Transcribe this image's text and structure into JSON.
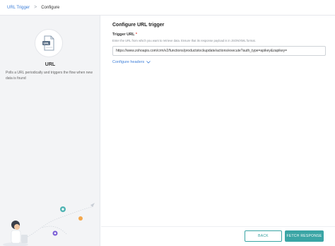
{
  "breadcrumb": {
    "parent": "URL Trigger",
    "separator": ">",
    "current": "Configure"
  },
  "app": {
    "icon_name": "url-file-icon",
    "icon_text": "URL",
    "name": "URL",
    "description": "Polls a URL periodically and triggers the flow when new data is found"
  },
  "form": {
    "section_title": "Configure URL trigger",
    "trigger_url_label": "Trigger URL",
    "required_mark": "*",
    "trigger_url_hint": "Enter the URL from which you want to retrieve data. Ensure that its response payload is in JSON/XML format.",
    "trigger_url_value": "https://www.zohoapis.com/crm/v2/functions/productstockupdate/actions/execute?auth_type=apikey&zapikey=",
    "configure_headers_label": "Configure headers"
  },
  "footer": {
    "back_label": "BACK",
    "fetch_label": "FETCH RESPONSE"
  },
  "colors": {
    "accent_teal": "#3aa5a5",
    "link_blue": "#3e7fd9",
    "required_red": "#e2453c"
  }
}
